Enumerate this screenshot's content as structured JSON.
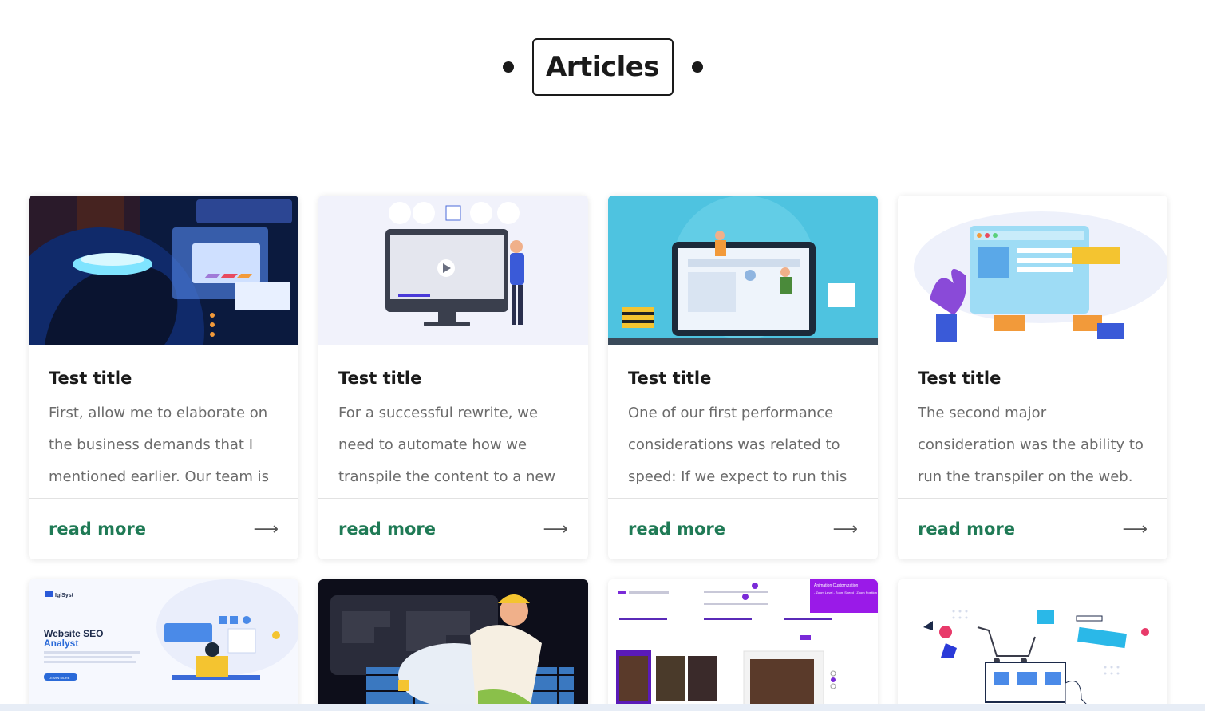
{
  "section": {
    "title": "Articles"
  },
  "articles": [
    {
      "title": "Test title",
      "excerpt": "First, allow me to elaborate on the business demands that I mentioned earlier. Our team is",
      "read_more": "read more",
      "image_icon": "neon-head-illustration"
    },
    {
      "title": "Test title",
      "excerpt": "For a successful rewrite, we need to automate how we transpile the content to a new system. We also",
      "read_more": "read more",
      "image_icon": "video-monitor-illustration"
    },
    {
      "title": "Test title",
      "excerpt": "One of our first performance considerations was related to speed: If we expect to run this",
      "read_more": "read more",
      "image_icon": "laptop-construction-illustration"
    },
    {
      "title": "Test title",
      "excerpt": "The second major consideration was the ability to run the transpiler on the web. Many",
      "read_more": "read more",
      "image_icon": "web-building-illustration"
    }
  ],
  "row2": {
    "seo_logo": "IgiSyst",
    "seo_heading": "Website SEO",
    "seo_heading_accent": "Analyst",
    "seo_button": "LEARN MORE",
    "zoom_panel": "Animation Customization",
    "zoom_items": "- Zoom Level - Zoom Speed - Zoom Position",
    "image_icons": [
      "seo-analyst-illustration",
      "phone-call-illustration",
      "image-zoom-settings-screenshot",
      "ecommerce-cart-illustration"
    ]
  },
  "colors": {
    "accent_green": "#1f7a55",
    "text_dark": "#1a1a1a",
    "text_muted": "#6b6b6b"
  }
}
